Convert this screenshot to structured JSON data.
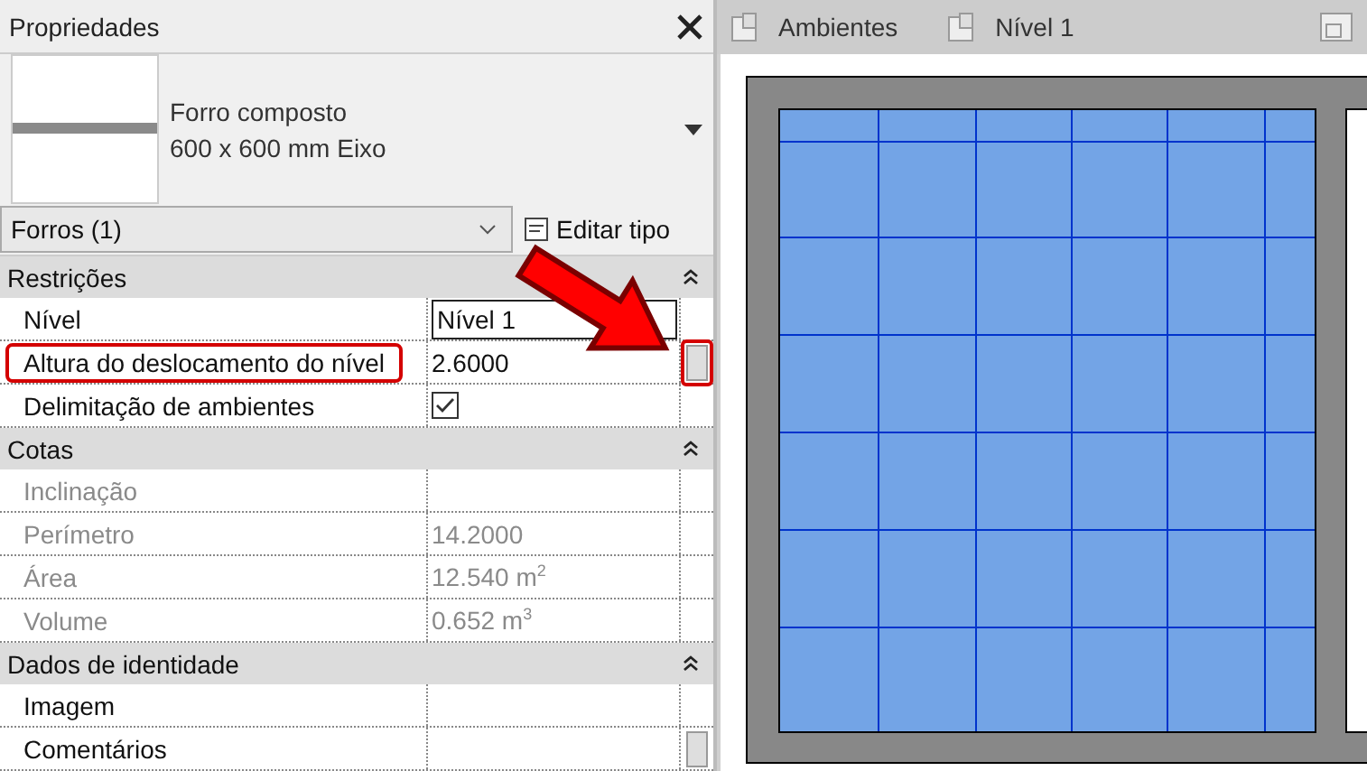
{
  "properties": {
    "title": "Propriedades",
    "type_name": "Forro composto",
    "type_variant": "600 x 600 mm Eixo",
    "category": "Forros (1)",
    "edit_type_button": "Editar tipo",
    "groups": [
      {
        "title": "Restrições",
        "rows": [
          {
            "label": "Nível",
            "value": "Nível 1",
            "kind": "field",
            "disabled": false,
            "annotated": false,
            "param_button": false
          },
          {
            "label": "Altura do deslocamento do nível",
            "value": "2.6000",
            "kind": "text",
            "disabled": false,
            "annotated": true,
            "param_button": true
          },
          {
            "label": "Delimitação de ambientes",
            "kind": "checkbox",
            "checked": true,
            "disabled": false,
            "annotated": false,
            "param_button": false
          }
        ]
      },
      {
        "title": "Cotas",
        "rows": [
          {
            "label": "Inclinação",
            "value": "",
            "kind": "text",
            "disabled": true,
            "annotated": false,
            "param_button": false
          },
          {
            "label": "Perímetro",
            "value": "14.2000",
            "kind": "text",
            "disabled": true,
            "annotated": false,
            "param_button": false
          },
          {
            "label": "Área",
            "value": "12.540 m$^{2}$",
            "kind": "text",
            "disabled": true,
            "annotated": false,
            "param_button": false
          },
          {
            "label": "Volume",
            "value": "0.652 m$^{3}$",
            "kind": "text",
            "disabled": true,
            "annotated": false,
            "param_button": false
          }
        ]
      },
      {
        "title": "Dados de identidade",
        "rows": [
          {
            "label": "Imagem",
            "value": "",
            "kind": "text",
            "disabled": false,
            "annotated": false,
            "param_button": false
          },
          {
            "label": "Comentários",
            "value": "",
            "kind": "text",
            "disabled": false,
            "annotated": false,
            "param_button": true
          }
        ]
      }
    ]
  },
  "view_tabs": [
    {
      "label": "Ambientes"
    },
    {
      "label": "Nível 1"
    }
  ]
}
